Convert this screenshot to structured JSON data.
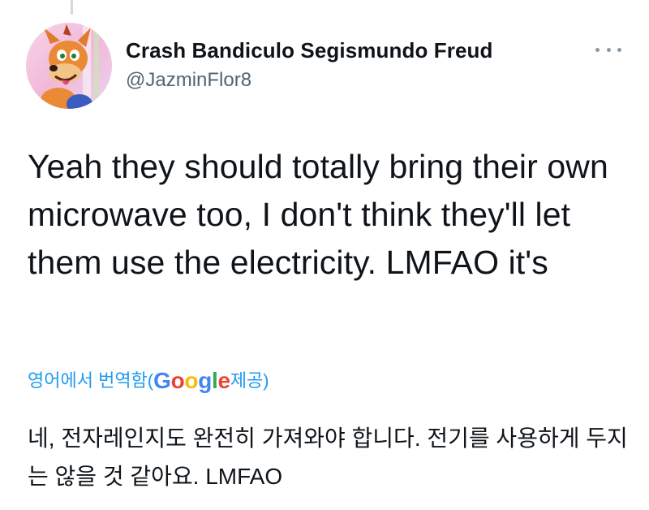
{
  "tweet": {
    "author": {
      "display_name": "Crash Bandiculo Segismundo Freud",
      "handle": "@JazminFlor8",
      "avatar_icon": "crash-bandicoot-avatar"
    },
    "more_icon": "more-horizontal-icon",
    "text": "Yeah they should totally bring their own microwave too, I don't think they'll let them use the electricity. LMFAO it's",
    "translation": {
      "link_prefix": "영어에서 번역함(",
      "provider": [
        "G",
        "o",
        "o",
        "g",
        "l",
        "e"
      ],
      "link_suffix": " 제공)",
      "text": "네, 전자레인지도 완전히 가져와야 합니다. 전기를 사용하게 두지는 않을 것 같아요. LMFAO"
    }
  },
  "colors": {
    "link": "#1d9bf0",
    "secondary_text": "#536471",
    "google_blue": "#4285f4",
    "google_red": "#ea4335",
    "google_yellow": "#fbbc05",
    "google_green": "#34a853"
  }
}
